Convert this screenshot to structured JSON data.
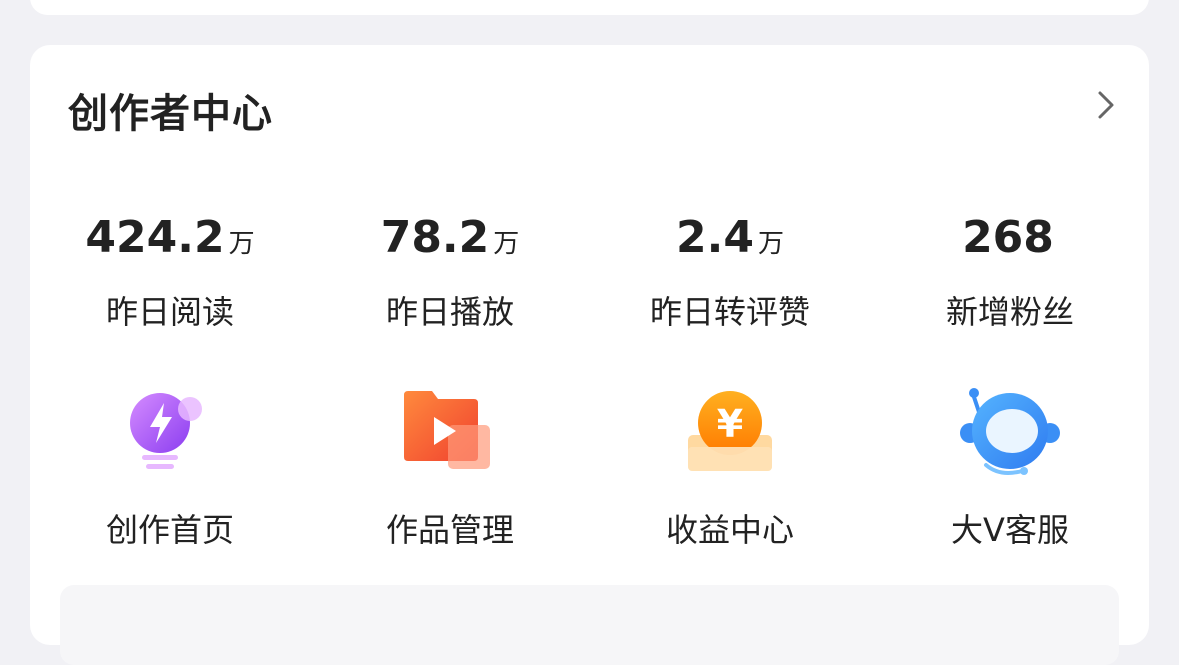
{
  "creator_center": {
    "title": "创作者中心",
    "stats": [
      {
        "value": "424.2",
        "unit": "万",
        "label": "昨日阅读"
      },
      {
        "value": "78.2",
        "unit": "万",
        "label": "昨日播放"
      },
      {
        "value": "2.4",
        "unit": "万",
        "label": "昨日转评赞"
      },
      {
        "value": "268",
        "unit": "",
        "label": "新增粉丝"
      }
    ],
    "tools": [
      {
        "label": "创作首页",
        "icon": "lightbulb-icon"
      },
      {
        "label": "作品管理",
        "icon": "video-folder-icon"
      },
      {
        "label": "收益中心",
        "icon": "yuan-coin-icon"
      },
      {
        "label": "大V客服",
        "icon": "headset-robot-icon"
      }
    ]
  },
  "colors": {
    "page_bg": "#f1f1f5",
    "card_bg": "#ffffff",
    "text": "#222222",
    "purple": "#a855f7",
    "orange": "#f97316",
    "gold": "#f59e0b",
    "blue": "#3b82f6"
  }
}
